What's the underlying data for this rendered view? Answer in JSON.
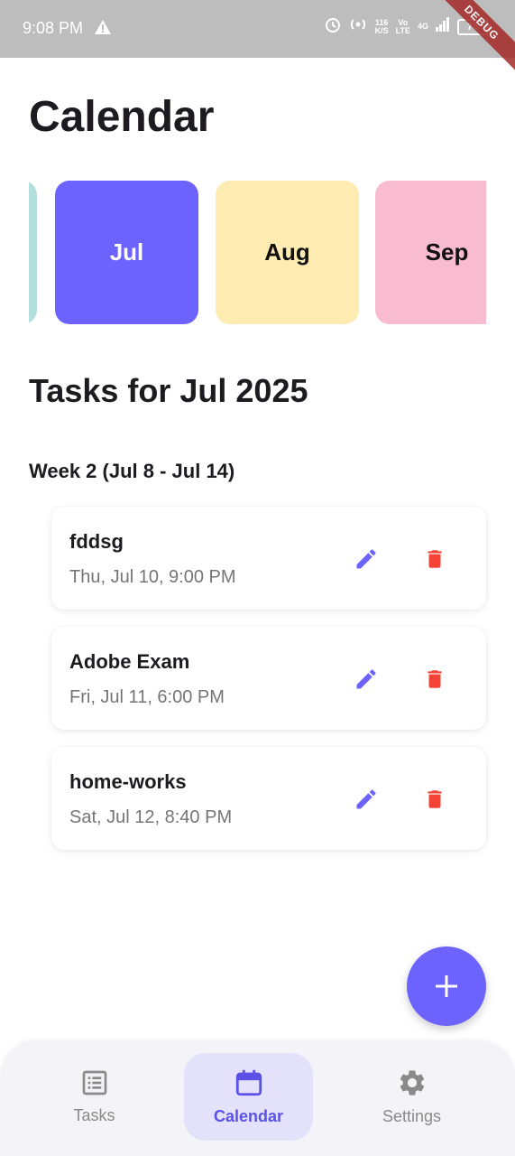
{
  "status_bar": {
    "time": "9:08 PM",
    "net_speed_top": "116",
    "net_speed_bottom": "K/S",
    "volte_top": "Vo",
    "volte_bottom": "LTE",
    "network_type": "4G",
    "battery": "74"
  },
  "debug_banner": "DEBUG",
  "page_title": "Calendar",
  "months": [
    {
      "label": ""
    },
    {
      "label": "Jul",
      "selected": true,
      "color": "#6c63ff"
    },
    {
      "label": "Aug",
      "color": "#ffecb3"
    },
    {
      "label": "Sep",
      "color": "#f8bbd0"
    }
  ],
  "tasks_heading": "Tasks for Jul 2025",
  "week_heading": "Week 2 (Jul 8 - Jul 14)",
  "tasks": [
    {
      "title": "fddsg",
      "datetime": "Thu, Jul 10, 9:00 PM"
    },
    {
      "title": "Adobe Exam",
      "datetime": "Fri, Jul 11, 6:00 PM"
    },
    {
      "title": "home-works",
      "datetime": "Sat, Jul 12, 8:40 PM"
    }
  ],
  "nav": {
    "tasks_label": "Tasks",
    "calendar_label": "Calendar",
    "settings_label": "Settings",
    "active": "Calendar"
  },
  "colors": {
    "accent": "#6c63ff",
    "delete": "#f44336",
    "edit": "#6c63ff"
  }
}
